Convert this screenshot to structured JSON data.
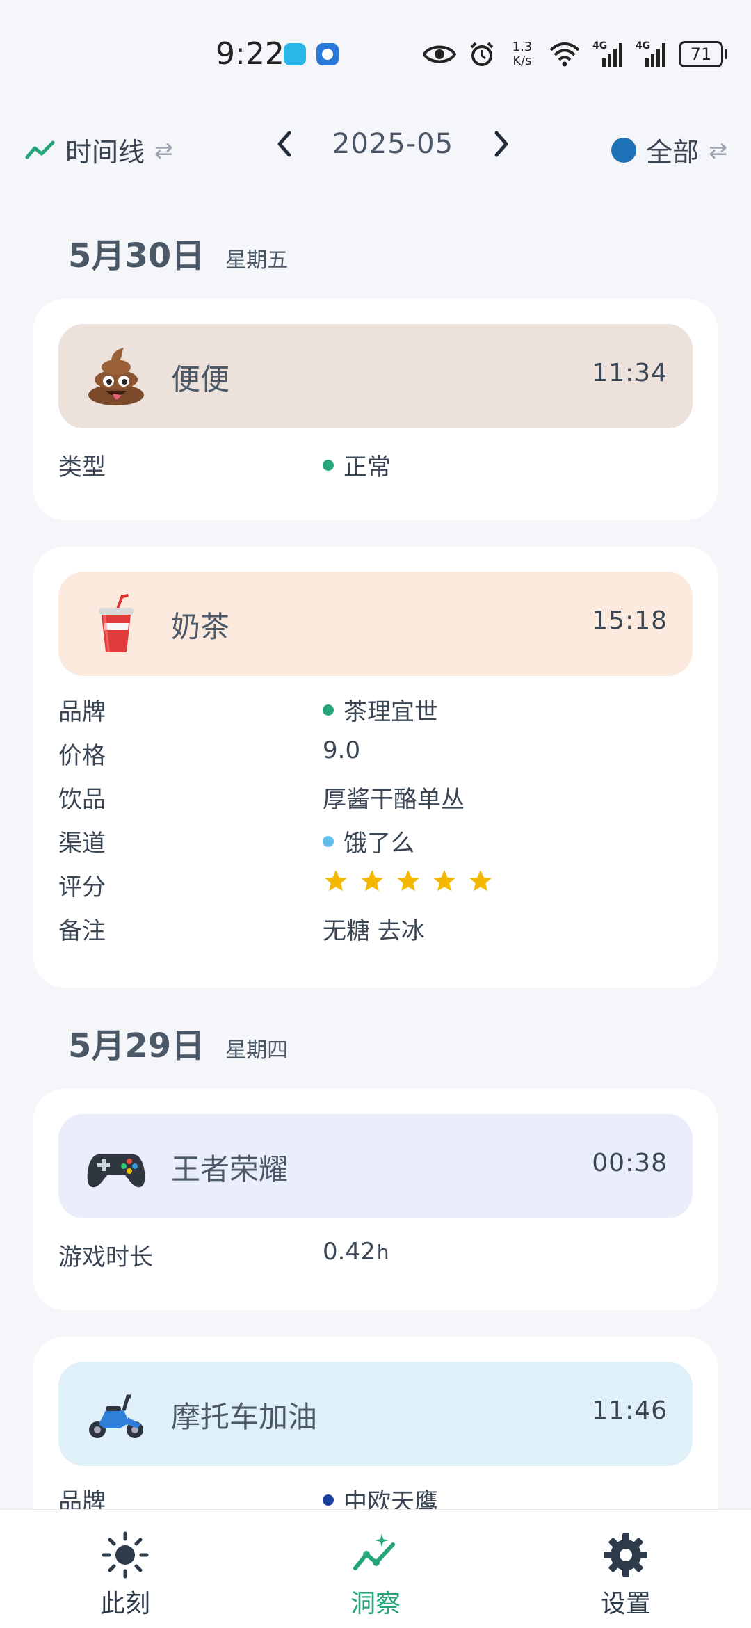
{
  "status_bar": {
    "time": "9:22",
    "net_speed_value": "1.3",
    "net_speed_unit": "K/s",
    "sim1_label": "4G",
    "sim2_label": "4G",
    "battery": "71"
  },
  "toolbar": {
    "view_label": "时间线",
    "month": "2025-05",
    "filter_label": "全部",
    "filter_color": "#1e72b8",
    "view_icon_color": "#26a57a"
  },
  "days": [
    {
      "date": "5月30日",
      "weekday": "星期五",
      "entries": [
        {
          "icon": "poop-emoji-icon",
          "title": "便便",
          "time": "11:34",
          "fields": [
            {
              "key": "类型",
              "value": "正常",
              "dot_color": "#26a57a"
            }
          ]
        },
        {
          "icon": "milk-tea-cup-icon",
          "title": "奶茶",
          "time": "15:18",
          "fields": [
            {
              "key": "品牌",
              "value": "茶理宜世",
              "dot_color": "#26a57a"
            },
            {
              "key": "价格",
              "value": "9.0"
            },
            {
              "key": "饮品",
              "value": "厚酱干酪单丛"
            },
            {
              "key": "渠道",
              "value": "饿了么",
              "dot_color": "#5fbde8"
            },
            {
              "key": "评分",
              "rating": 5
            },
            {
              "key": "备注",
              "value": "无糖 去冰"
            }
          ]
        }
      ]
    },
    {
      "date": "5月29日",
      "weekday": "星期四",
      "entries": [
        {
          "icon": "game-controller-icon",
          "title": "王者荣耀",
          "time": "00:38",
          "fields": [
            {
              "key": "游戏时长",
              "value": "0.42",
              "unit": "h"
            }
          ]
        },
        {
          "icon": "motor-scooter-icon",
          "title": "摩托车加油",
          "time": "11:46",
          "fields": [
            {
              "key": "品牌",
              "value": "中欧天鹰",
              "dot_color": "#1a3f9e"
            }
          ]
        }
      ]
    }
  ],
  "bottom_nav": {
    "items": [
      {
        "label": "此刻",
        "active": false
      },
      {
        "label": "洞察",
        "active": true
      },
      {
        "label": "设置",
        "active": false
      }
    ],
    "active_color": "#26a57a",
    "inactive_color": "#2c3a4a"
  }
}
